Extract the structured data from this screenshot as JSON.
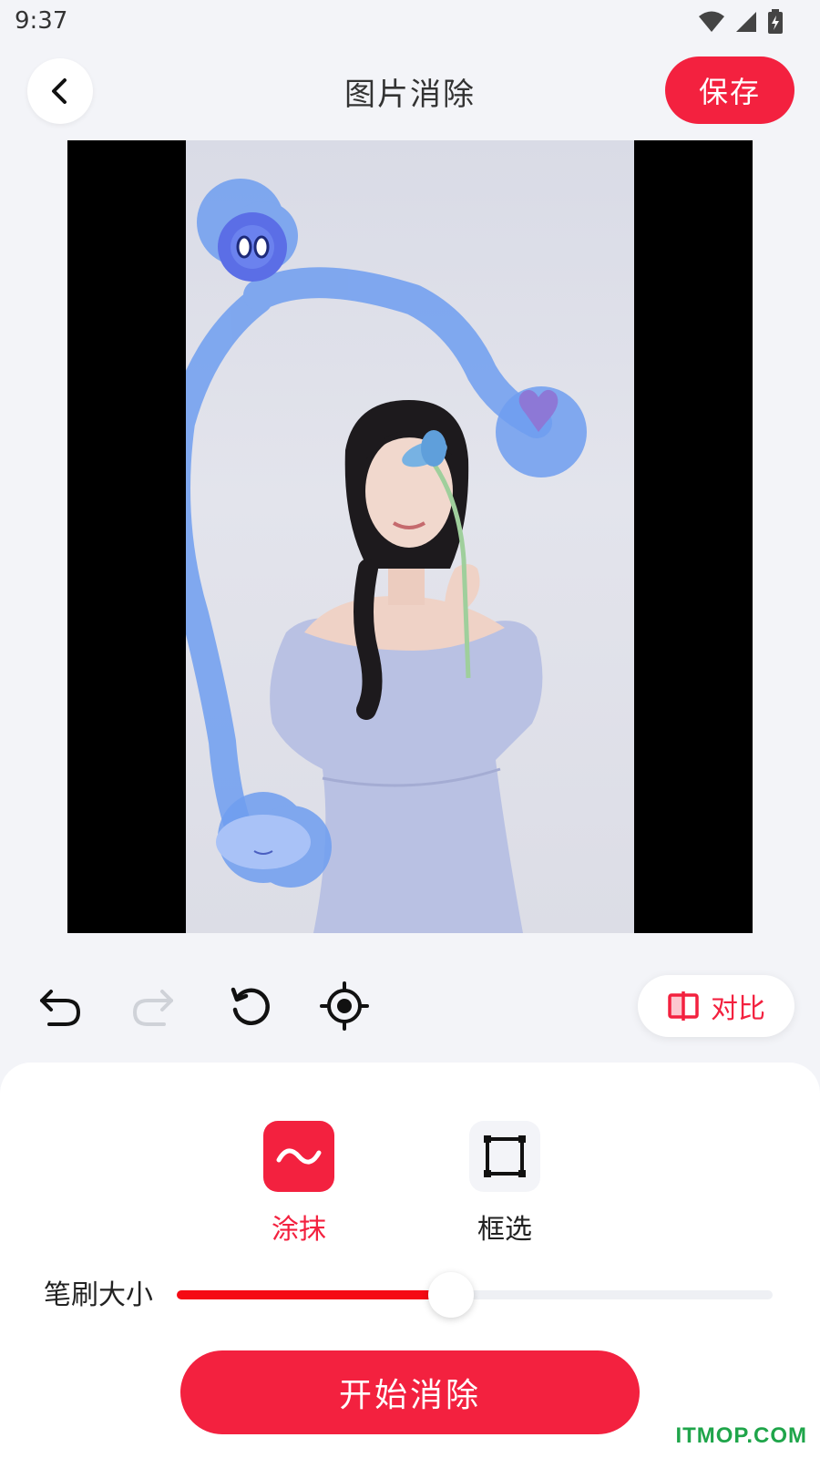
{
  "status_bar": {
    "time": "9:37"
  },
  "header": {
    "title": "图片消除",
    "save_label": "保存"
  },
  "toolbar": {
    "compare_label": "对比"
  },
  "modes": [
    {
      "label": "涂抹",
      "active": true,
      "icon": "wave-icon"
    },
    {
      "label": "框选",
      "active": false,
      "icon": "square-select-icon"
    }
  ],
  "brush": {
    "label": "笔刷大小",
    "value_percent": 46
  },
  "actions": {
    "start_label": "开始消除"
  },
  "watermark": "ITMOP.COM",
  "colors": {
    "accent": "#f3213f",
    "slider_fill": "#f50a14",
    "brush_stroke": "#6f9ef0"
  }
}
